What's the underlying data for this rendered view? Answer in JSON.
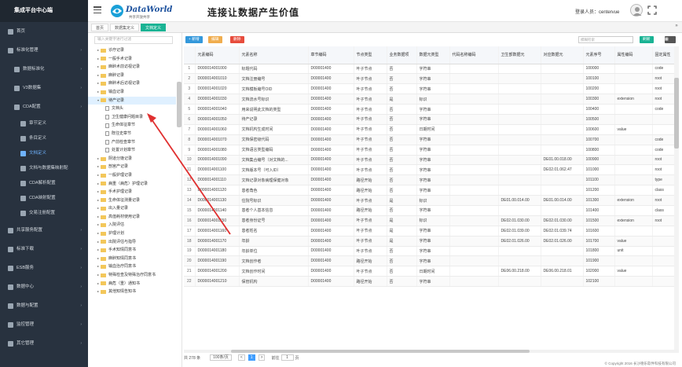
{
  "app": {
    "title": "集成平台中心端"
  },
  "sidebar": {
    "items": [
      {
        "label": "首页"
      },
      {
        "label": "标准化管理"
      },
      {
        "label": "数据标准化"
      },
      {
        "label": "V3数据集"
      },
      {
        "label": "CDA配置"
      },
      {
        "label": "章节定义"
      },
      {
        "label": "条目定义"
      },
      {
        "label": "文档定义"
      },
      {
        "label": "文档与数据集映射配"
      },
      {
        "label": "CDA解析配置"
      },
      {
        "label": "CDA映射配置"
      },
      {
        "label": "交易注册配置"
      },
      {
        "label": "共享服务配置"
      },
      {
        "label": "标准下载"
      },
      {
        "label": "ESB服务"
      },
      {
        "label": "数据中心"
      },
      {
        "label": "数据与配置"
      },
      {
        "label": "监控管理"
      },
      {
        "label": "其它管理"
      }
    ]
  },
  "header": {
    "logo_text": "DataWorld",
    "logo_sub": "共享开放共享",
    "slogan": "连接让数据产生价值",
    "user_label": "登录人员：centervue"
  },
  "tabs": [
    {
      "label": "首页"
    },
    {
      "label": "数据集定义"
    },
    {
      "label": "文档定义"
    }
  ],
  "tree": {
    "search_placeholder": "输入关键字进行过滤",
    "nodes": [
      {
        "label": "诊疗记录",
        "type": "folder"
      },
      {
        "label": "一般手术记录",
        "type": "folder"
      },
      {
        "label": "麻醉术前访视记录",
        "type": "folder"
      },
      {
        "label": "麻醉记录",
        "type": "folder"
      },
      {
        "label": "麻醉术后访视记录",
        "type": "folder"
      },
      {
        "label": "输血记录",
        "type": "folder"
      },
      {
        "label": "待产记录",
        "type": "folder-open"
      },
      {
        "label": "文档头",
        "type": "doc"
      },
      {
        "label": "卫生健康问题目录",
        "type": "doc"
      },
      {
        "label": "生命体征章节",
        "type": "doc"
      },
      {
        "label": "既往史章节",
        "type": "doc"
      },
      {
        "label": "产前检查章节",
        "type": "doc"
      },
      {
        "label": "处置计划章节",
        "type": "doc"
      },
      {
        "label": "阴道分娩记录",
        "type": "folder"
      },
      {
        "label": "剖宫产记录",
        "type": "folder"
      },
      {
        "label": "一般护理记录",
        "type": "folder"
      },
      {
        "label": "病重（病危）护理记录",
        "type": "folder"
      },
      {
        "label": "手术护理记录",
        "type": "folder"
      },
      {
        "label": "生命体征测量记录",
        "type": "folder"
      },
      {
        "label": "出入量记录",
        "type": "folder"
      },
      {
        "label": "高值耗材使用记录",
        "type": "folder"
      },
      {
        "label": "入院评估",
        "type": "folder"
      },
      {
        "label": "护理计划",
        "type": "folder"
      },
      {
        "label": "出院评估与指导",
        "type": "folder"
      },
      {
        "label": "手术知情同意书",
        "type": "folder"
      },
      {
        "label": "麻醉知情同意书",
        "type": "folder"
      },
      {
        "label": "输血治疗同意书",
        "type": "folder"
      },
      {
        "label": "特殊检查及特殊治疗同意书",
        "type": "folder"
      },
      {
        "label": "病危（重）通知书",
        "type": "folder"
      },
      {
        "label": "其他知情告知书",
        "type": "folder"
      }
    ]
  },
  "toolbar": {
    "add": "+ 新增",
    "edit": "编辑",
    "delete": "删除",
    "search_placeholder": "模糊检索",
    "refresh": "刷新"
  },
  "grid": {
    "columns": [
      "",
      "元素编码",
      "元素名称",
      "章节编码",
      "节点类型",
      "业务数据项",
      "数据元类型",
      "代码名称编码",
      "卫生部数据元",
      "对应数据元",
      "元素序号",
      "属性编码",
      "固定属性"
    ],
    "rows": [
      [
        "1",
        "D000014001000",
        "标题代码",
        "D00001400",
        "叶子节点",
        "否",
        "字符串",
        "",
        "",
        "",
        "100000",
        "",
        "code"
      ],
      [
        "2",
        "D000014001010",
        "文档注册编号",
        "D00001400",
        "叶子节点",
        "否",
        "字符串",
        "",
        "",
        "",
        "100100",
        "",
        "root"
      ],
      [
        "3",
        "D000014001020",
        "文档模板编号OID",
        "D00001400",
        "叶子节点",
        "否",
        "字符串",
        "",
        "",
        "",
        "100200",
        "",
        "root"
      ],
      [
        "4",
        "D000014001030",
        "文档流水号标识",
        "D00001400",
        "叶子节点",
        "是",
        "标识",
        "",
        "",
        "",
        "100300",
        "extension",
        "root"
      ],
      [
        "5",
        "D000014001040",
        "用来说明此文档的类型",
        "D00001400",
        "叶子节点",
        "否",
        "字符串",
        "",
        "",
        "",
        "100400",
        "",
        "code"
      ],
      [
        "6",
        "D000014001050",
        "待产记录",
        "D00001400",
        "叶子节点",
        "否",
        "字符串",
        "",
        "",
        "",
        "100500",
        "",
        ""
      ],
      [
        "7",
        "D000014001060",
        "文档机构生成时间",
        "D00001400",
        "叶子节点",
        "否",
        "日期时间",
        "",
        "",
        "",
        "100600",
        "value",
        ""
      ],
      [
        "8",
        "D000014001070",
        "文档保密级代码",
        "D00001400",
        "叶子节点",
        "否",
        "字符串",
        "",
        "",
        "",
        "100700",
        "",
        "code"
      ],
      [
        "9",
        "D000014001080",
        "文档语言类型编码",
        "D00001400",
        "叶子节点",
        "否",
        "字符串",
        "",
        "",
        "",
        "100800",
        "",
        "code"
      ],
      [
        "10",
        "D000014001090",
        "文档集合编号（对文档的...",
        "D00001400",
        "叶子节点",
        "否",
        "字符串",
        "",
        "",
        "DE01.00.018.00",
        "100900",
        "",
        "root"
      ],
      [
        "11",
        "D000014001100",
        "文档版本号（可入ID）",
        "D00001400",
        "叶子节点",
        "否",
        "字符串",
        "",
        "",
        "DE02.01.062.47",
        "101000",
        "",
        "root"
      ],
      [
        "12",
        "D000014001110",
        "文档记录对象病理保健对象",
        "D00001400",
        "路径开始",
        "否",
        "字符串",
        "",
        "",
        "",
        "101100",
        "",
        "type"
      ],
      [
        "13",
        "D000014001120",
        "患者角色",
        "D00001400",
        "路径开始",
        "否",
        "字符串",
        "",
        "",
        "",
        "101200",
        "",
        "class"
      ],
      [
        "14",
        "D000014001130",
        "住院号标识",
        "D00001400",
        "叶子节点",
        "是",
        "标识",
        "",
        "DE01.00.014.00",
        "DE01.00.014.00",
        "101300",
        "extension",
        "root"
      ],
      [
        "15",
        "D000014001140",
        "患者个人基本信息",
        "D00001400",
        "路径开始",
        "否",
        "字符串",
        "",
        "",
        "",
        "101400",
        "",
        "class"
      ],
      [
        "16",
        "D000014001150",
        "患者身份证号",
        "D00001400",
        "叶子节点",
        "是",
        "标识",
        "",
        "DE02.01.030.00",
        "DE02.01.030.00",
        "101500",
        "extension",
        "root"
      ],
      [
        "17",
        "D000014001160",
        "患者姓名",
        "D00001400",
        "叶子节点",
        "是",
        "字符串",
        "",
        "DE02.01.039.00",
        "DE02.01.039.74",
        "101600",
        "",
        ""
      ],
      [
        "18",
        "D000014001170",
        "年龄",
        "D00001400",
        "叶子节点",
        "是",
        "字符串",
        "",
        "DE02.01.026.00",
        "DE02.01.026.00",
        "101700",
        "value",
        ""
      ],
      [
        "19",
        "D000014001180",
        "年龄单位",
        "D00001400",
        "叶子节点",
        "否",
        "字符串",
        "",
        "",
        "",
        "101800",
        "unit",
        ""
      ],
      [
        "20",
        "D000014001190",
        "文档创作者",
        "D00001400",
        "路径开始",
        "否",
        "字符串",
        "",
        "",
        "",
        "101900",
        "",
        ""
      ],
      [
        "21",
        "D000014001200",
        "文档创作时间",
        "D00001400",
        "叶子节点",
        "否",
        "日期时间",
        "",
        "DE06.00.218.00",
        "DE06.00.218.01",
        "102000",
        "value",
        ""
      ],
      [
        "22",
        "D000014001210",
        "保管机构",
        "D00001400",
        "路径开始",
        "否",
        "字符串",
        "",
        "",
        "",
        "102100",
        "",
        ""
      ]
    ]
  },
  "pager": {
    "total": "共 278 条",
    "page_size": "100条/页",
    "prev": "<",
    "next": ">",
    "goto_label": "前往",
    "page": "1",
    "page_unit": "页"
  },
  "footer": {
    "copyright": "© Copyright 2016 长沙德乐软件科技有限公司"
  },
  "colors": {
    "sidebar_bg": "#28323f",
    "accent": "#1ab394",
    "primary": "#3498db",
    "annotation": "#e03030"
  }
}
